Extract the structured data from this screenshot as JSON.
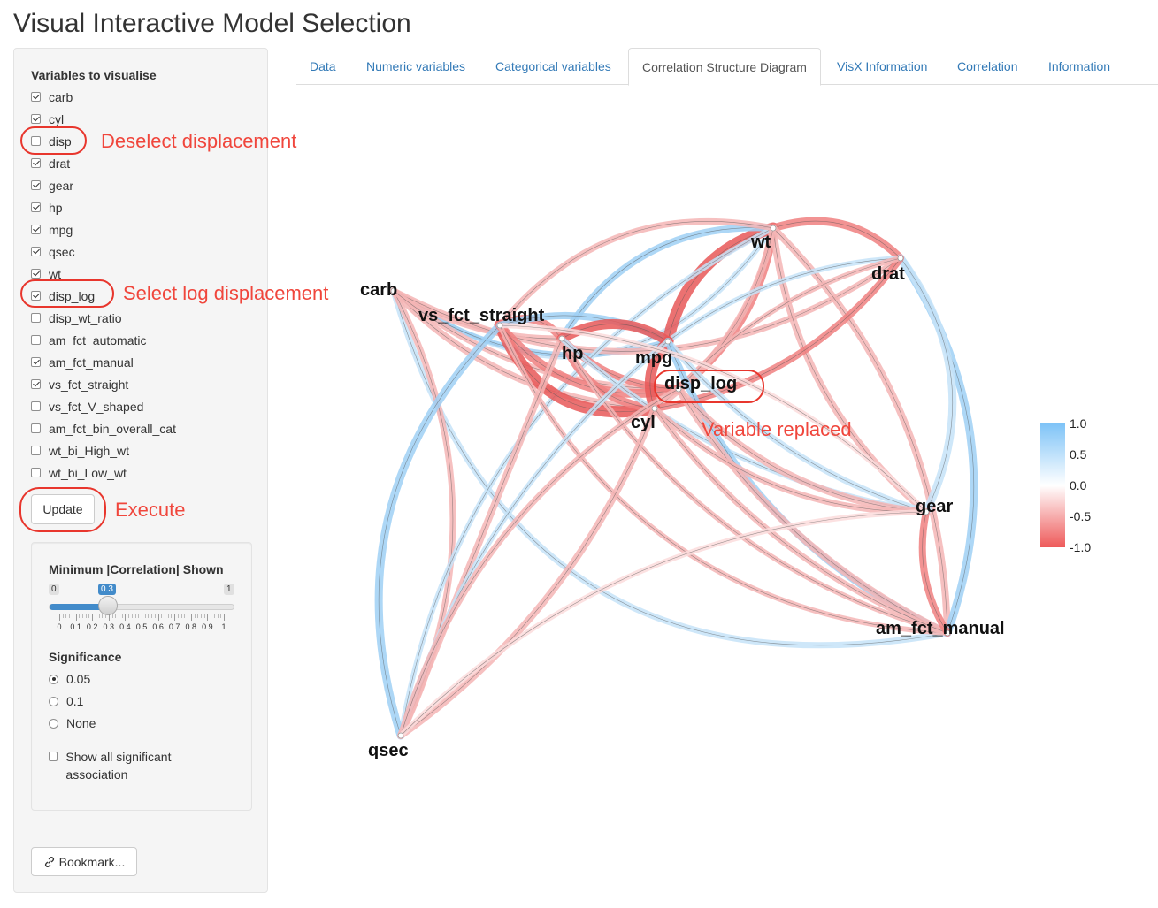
{
  "app_title": "Visual Interactive Model Selection",
  "sidebar": {
    "heading": "Variables to visualise",
    "variables": [
      {
        "label": "carb",
        "checked": true
      },
      {
        "label": "cyl",
        "checked": true
      },
      {
        "label": "disp",
        "checked": false
      },
      {
        "label": "drat",
        "checked": true
      },
      {
        "label": "gear",
        "checked": true
      },
      {
        "label": "hp",
        "checked": true
      },
      {
        "label": "mpg",
        "checked": true
      },
      {
        "label": "qsec",
        "checked": true
      },
      {
        "label": "wt",
        "checked": true
      },
      {
        "label": "disp_log",
        "checked": true
      },
      {
        "label": "disp_wt_ratio",
        "checked": false
      },
      {
        "label": "am_fct_automatic",
        "checked": false
      },
      {
        "label": "am_fct_manual",
        "checked": true
      },
      {
        "label": "vs_fct_straight",
        "checked": true
      },
      {
        "label": "vs_fct_V_shaped",
        "checked": false
      },
      {
        "label": "am_fct_bin_overall_cat",
        "checked": false
      },
      {
        "label": "wt_bi_High_wt",
        "checked": false
      },
      {
        "label": "wt_bi_Low_wt",
        "checked": false
      }
    ],
    "update_label": "Update",
    "bookmark_label": "Bookmark..."
  },
  "controls": {
    "min_corr_heading": "Minimum |Correlation| Shown",
    "slider": {
      "min": 0,
      "max": 1,
      "value": 0.3,
      "min_label": "0",
      "max_label": "1",
      "value_label": "0.3"
    },
    "slider_ticks": [
      "0",
      "0.1",
      "0.2",
      "0.3",
      "0.4",
      "0.5",
      "0.6",
      "0.7",
      "0.8",
      "0.9",
      "1"
    ],
    "significance_heading": "Significance",
    "significance_options": [
      {
        "label": "0.05",
        "selected": true
      },
      {
        "label": "0.1",
        "selected": false
      },
      {
        "label": "None",
        "selected": false
      }
    ],
    "show_all_label": "Show all significant association"
  },
  "tabs": [
    {
      "label": "Data",
      "active": false
    },
    {
      "label": "Numeric variables",
      "active": false
    },
    {
      "label": "Categorical variables",
      "active": false
    },
    {
      "label": "Correlation Structure Diagram",
      "active": true
    },
    {
      "label": "VisX Information",
      "active": false
    },
    {
      "label": "Correlation",
      "active": false
    },
    {
      "label": "Information",
      "active": false
    }
  ],
  "annotations": {
    "deselect": "Deselect displacement",
    "select_log": "Select log displacement",
    "execute": "Execute",
    "replaced": "Variable replaced"
  },
  "diagram": {
    "nodes": [
      "wt",
      "drat",
      "carb",
      "vs_fct_straight",
      "hp",
      "mpg",
      "disp_log",
      "cyl",
      "gear",
      "am_fct_manual",
      "qsec"
    ],
    "legend": {
      "labels": [
        "1.0",
        "0.5",
        "0.0",
        "-0.5",
        "-1.0"
      ],
      "positive_color": "#7ec3f7",
      "negative_color": "#ee5a5a"
    }
  }
}
